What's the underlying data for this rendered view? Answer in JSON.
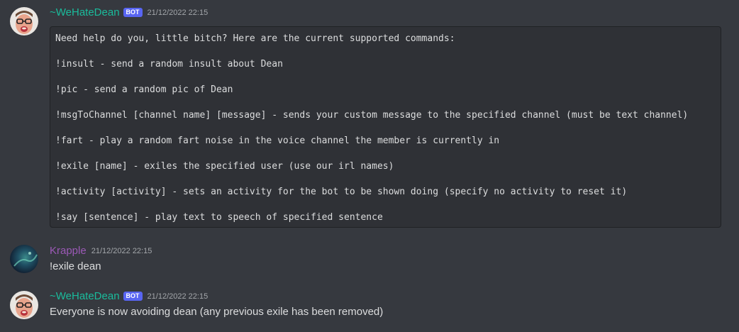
{
  "messages": [
    {
      "author": "~WeHateDean",
      "author_color": "#1abc9c",
      "bot_tag": "BOT",
      "timestamp": "21/12/2022 22:15",
      "code_lines": [
        "Need help do you, little bitch? Here are the current supported commands:",
        "!insult - send a random insult about Dean",
        "!pic - send a random pic of Dean",
        "!msgToChannel [channel name] [message] - sends your custom message to the specified channel (must be text channel)",
        "!fart - play a random fart noise in the voice channel the member is currently in",
        "!exile [name] - exiles the specified user (use our irl names)",
        "!activity [activity] - sets an activity for the bot to be shown doing (specify no activity to reset it)",
        "!say [sentence] - play text to speech of specified sentence"
      ]
    },
    {
      "author": "Krapple",
      "author_color": "#9b59b6",
      "timestamp": "21/12/2022 22:15",
      "text": "!exile dean"
    },
    {
      "author": "~WeHateDean",
      "author_color": "#1abc9c",
      "bot_tag": "BOT",
      "timestamp": "21/12/2022 22:15",
      "text": "Everyone is now avoiding dean (any previous exile has been removed)"
    }
  ]
}
